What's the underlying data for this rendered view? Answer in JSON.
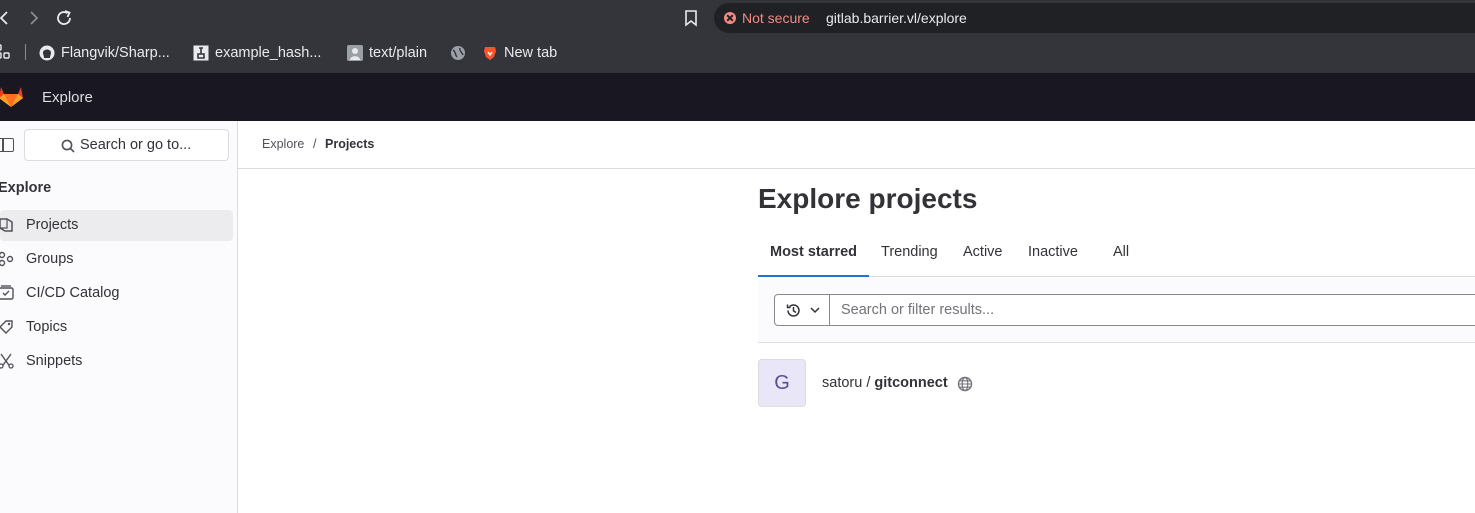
{
  "browser": {
    "security_label": "Not secure",
    "url": "gitlab.barrier.vl/explore",
    "bookmarks": [
      {
        "label": "Flangvik/Sharp...",
        "icon": "github-icon"
      },
      {
        "label": "example_hash...",
        "icon": "hashcat-icon"
      },
      {
        "label": "text/plain",
        "icon": "profile-icon"
      },
      {
        "label": "",
        "icon": "globe-icon"
      },
      {
        "label": "New tab",
        "icon": "brave-icon"
      }
    ]
  },
  "topbar": {
    "title": "Explore"
  },
  "sidebar": {
    "search_label": "Search or go to...",
    "heading": "Explore",
    "items": [
      {
        "label": "Projects",
        "icon": "project-icon",
        "active": true
      },
      {
        "label": "Groups",
        "icon": "group-icon",
        "active": false
      },
      {
        "label": "CI/CD Catalog",
        "icon": "catalog-icon",
        "active": false
      },
      {
        "label": "Topics",
        "icon": "label-icon",
        "active": false
      },
      {
        "label": "Snippets",
        "icon": "snippet-icon",
        "active": false
      }
    ]
  },
  "breadcrumb": {
    "items": [
      "Explore",
      "Projects"
    ],
    "separator": "/"
  },
  "main": {
    "title": "Explore projects",
    "tabs": [
      {
        "label": "Most starred",
        "active": true
      },
      {
        "label": "Trending",
        "active": false
      },
      {
        "label": "Active",
        "active": false
      },
      {
        "label": "Inactive",
        "active": false
      },
      {
        "label": "All",
        "active": false
      }
    ],
    "filter": {
      "placeholder": "Search or filter results..."
    },
    "projects": [
      {
        "avatar_letter": "G",
        "namespace": "satoru /",
        "name": "gitconnect",
        "visibility_icon": "globe-icon"
      }
    ]
  },
  "colors": {
    "accent": "#1f75cb",
    "topbar": "#181722",
    "warning": "#f28b82"
  }
}
